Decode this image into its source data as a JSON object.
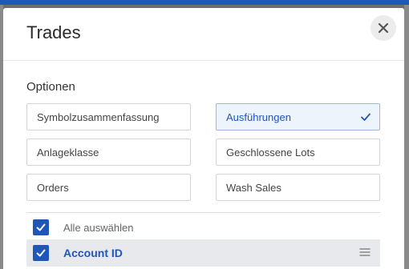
{
  "modal": {
    "title": "Trades",
    "close_icon": "close-icon"
  },
  "options": {
    "label": "Optionen",
    "items": [
      {
        "label": "Symbolzusammenfassung",
        "selected": false
      },
      {
        "label": "Ausführungen",
        "selected": true
      },
      {
        "label": "Anlageklasse",
        "selected": false
      },
      {
        "label": "Geschlossene Lots",
        "selected": false
      },
      {
        "label": "Orders",
        "selected": false
      },
      {
        "label": "Wash Sales",
        "selected": false
      }
    ]
  },
  "fields": {
    "select_all_label": "Alle auswählen",
    "select_all_checked": true,
    "rows": [
      {
        "label": "Account ID",
        "checked": true
      }
    ]
  },
  "colors": {
    "accent": "#1f56b8",
    "selected_bg": "#eef4fb",
    "row_highlight": "#e7e9ec"
  }
}
